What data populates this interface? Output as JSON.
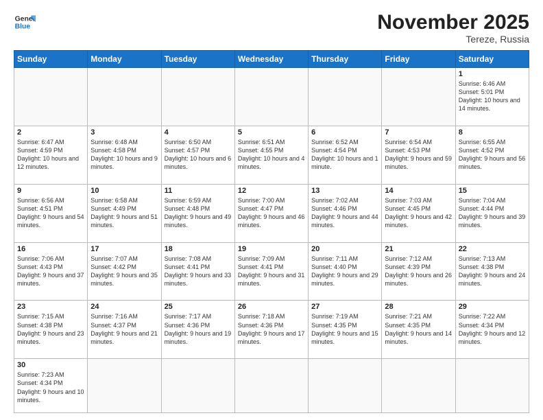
{
  "logo": {
    "line1": "General",
    "line2": "Blue"
  },
  "title": "November 2025",
  "location": "Tereze, Russia",
  "days_of_week": [
    "Sunday",
    "Monday",
    "Tuesday",
    "Wednesday",
    "Thursday",
    "Friday",
    "Saturday"
  ],
  "weeks": [
    [
      {
        "num": "",
        "info": ""
      },
      {
        "num": "",
        "info": ""
      },
      {
        "num": "",
        "info": ""
      },
      {
        "num": "",
        "info": ""
      },
      {
        "num": "",
        "info": ""
      },
      {
        "num": "",
        "info": ""
      },
      {
        "num": "1",
        "info": "Sunrise: 6:46 AM\nSunset: 5:01 PM\nDaylight: 10 hours\nand 14 minutes."
      }
    ],
    [
      {
        "num": "2",
        "info": "Sunrise: 6:47 AM\nSunset: 4:59 PM\nDaylight: 10 hours\nand 12 minutes."
      },
      {
        "num": "3",
        "info": "Sunrise: 6:48 AM\nSunset: 4:58 PM\nDaylight: 10 hours\nand 9 minutes."
      },
      {
        "num": "4",
        "info": "Sunrise: 6:50 AM\nSunset: 4:57 PM\nDaylight: 10 hours\nand 6 minutes."
      },
      {
        "num": "5",
        "info": "Sunrise: 6:51 AM\nSunset: 4:55 PM\nDaylight: 10 hours\nand 4 minutes."
      },
      {
        "num": "6",
        "info": "Sunrise: 6:52 AM\nSunset: 4:54 PM\nDaylight: 10 hours\nand 1 minute."
      },
      {
        "num": "7",
        "info": "Sunrise: 6:54 AM\nSunset: 4:53 PM\nDaylight: 9 hours\nand 59 minutes."
      },
      {
        "num": "8",
        "info": "Sunrise: 6:55 AM\nSunset: 4:52 PM\nDaylight: 9 hours\nand 56 minutes."
      }
    ],
    [
      {
        "num": "9",
        "info": "Sunrise: 6:56 AM\nSunset: 4:51 PM\nDaylight: 9 hours\nand 54 minutes."
      },
      {
        "num": "10",
        "info": "Sunrise: 6:58 AM\nSunset: 4:49 PM\nDaylight: 9 hours\nand 51 minutes."
      },
      {
        "num": "11",
        "info": "Sunrise: 6:59 AM\nSunset: 4:48 PM\nDaylight: 9 hours\nand 49 minutes."
      },
      {
        "num": "12",
        "info": "Sunrise: 7:00 AM\nSunset: 4:47 PM\nDaylight: 9 hours\nand 46 minutes."
      },
      {
        "num": "13",
        "info": "Sunrise: 7:02 AM\nSunset: 4:46 PM\nDaylight: 9 hours\nand 44 minutes."
      },
      {
        "num": "14",
        "info": "Sunrise: 7:03 AM\nSunset: 4:45 PM\nDaylight: 9 hours\nand 42 minutes."
      },
      {
        "num": "15",
        "info": "Sunrise: 7:04 AM\nSunset: 4:44 PM\nDaylight: 9 hours\nand 39 minutes."
      }
    ],
    [
      {
        "num": "16",
        "info": "Sunrise: 7:06 AM\nSunset: 4:43 PM\nDaylight: 9 hours\nand 37 minutes."
      },
      {
        "num": "17",
        "info": "Sunrise: 7:07 AM\nSunset: 4:42 PM\nDaylight: 9 hours\nand 35 minutes."
      },
      {
        "num": "18",
        "info": "Sunrise: 7:08 AM\nSunset: 4:41 PM\nDaylight: 9 hours\nand 33 minutes."
      },
      {
        "num": "19",
        "info": "Sunrise: 7:09 AM\nSunset: 4:41 PM\nDaylight: 9 hours\nand 31 minutes."
      },
      {
        "num": "20",
        "info": "Sunrise: 7:11 AM\nSunset: 4:40 PM\nDaylight: 9 hours\nand 29 minutes."
      },
      {
        "num": "21",
        "info": "Sunrise: 7:12 AM\nSunset: 4:39 PM\nDaylight: 9 hours\nand 26 minutes."
      },
      {
        "num": "22",
        "info": "Sunrise: 7:13 AM\nSunset: 4:38 PM\nDaylight: 9 hours\nand 24 minutes."
      }
    ],
    [
      {
        "num": "23",
        "info": "Sunrise: 7:15 AM\nSunset: 4:38 PM\nDaylight: 9 hours\nand 23 minutes."
      },
      {
        "num": "24",
        "info": "Sunrise: 7:16 AM\nSunset: 4:37 PM\nDaylight: 9 hours\nand 21 minutes."
      },
      {
        "num": "25",
        "info": "Sunrise: 7:17 AM\nSunset: 4:36 PM\nDaylight: 9 hours\nand 19 minutes."
      },
      {
        "num": "26",
        "info": "Sunrise: 7:18 AM\nSunset: 4:36 PM\nDaylight: 9 hours\nand 17 minutes."
      },
      {
        "num": "27",
        "info": "Sunrise: 7:19 AM\nSunset: 4:35 PM\nDaylight: 9 hours\nand 15 minutes."
      },
      {
        "num": "28",
        "info": "Sunrise: 7:21 AM\nSunset: 4:35 PM\nDaylight: 9 hours\nand 14 minutes."
      },
      {
        "num": "29",
        "info": "Sunrise: 7:22 AM\nSunset: 4:34 PM\nDaylight: 9 hours\nand 12 minutes."
      }
    ],
    [
      {
        "num": "30",
        "info": "Sunrise: 7:23 AM\nSunset: 4:34 PM\nDaylight: 9 hours\nand 10 minutes."
      },
      {
        "num": "",
        "info": ""
      },
      {
        "num": "",
        "info": ""
      },
      {
        "num": "",
        "info": ""
      },
      {
        "num": "",
        "info": ""
      },
      {
        "num": "",
        "info": ""
      },
      {
        "num": "",
        "info": ""
      }
    ]
  ]
}
